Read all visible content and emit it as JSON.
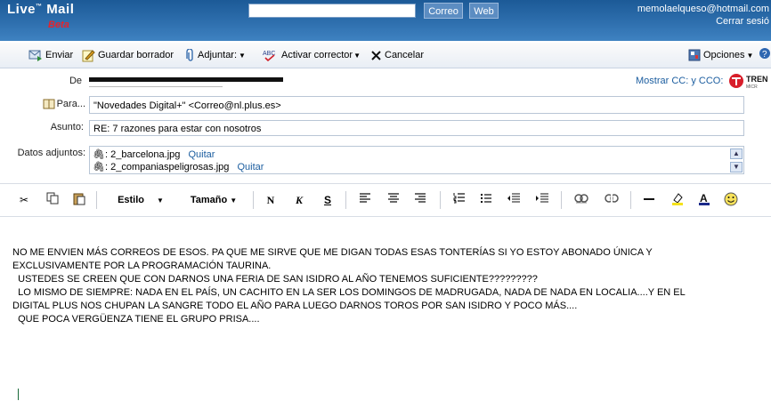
{
  "header": {
    "logo": "Live",
    "logo_tm": "™",
    "logo_product": "Mail",
    "beta": "Beta",
    "search_value": "",
    "btn_correo": "Correo",
    "btn_web": "Web",
    "user_email": "memolaelqueso@hotmail.com",
    "signout": "Cerrar sesió"
  },
  "toolbar": {
    "send": "Enviar",
    "save_draft": "Guardar borrador",
    "attach": "Adjuntar:",
    "spell": "Activar corrector",
    "cancel": "Cancelar",
    "options": "Opciones"
  },
  "compose": {
    "from_label": "De",
    "to_label": "Para...",
    "to_value": "\"Novedades Digital+\" <Correo@nl.plus.es>",
    "subject_label": "Asunto:",
    "subject_value": "RE: 7 razones para estar con nosotros",
    "attachments_label": "Datos adjuntos:",
    "attachments": [
      {
        "name": "2_barcelona.jpg",
        "remove": "Quitar"
      },
      {
        "name": "2_companiaspeligrosas.jpg",
        "remove": "Quitar"
      }
    ],
    "cc_link": "Mostrar CC: y CCO:",
    "trend_text": "TREN",
    "trend_sub": "MICR"
  },
  "format": {
    "style": "Estilo",
    "size": "Tamaño",
    "bold": "N",
    "italic": "K",
    "underline": "S"
  },
  "body_lines": [
    "NO ME ENVIEN MÁS CORREOS DE ESOS. PA QUE ME SIRVE QUE ME DIGAN TODAS ESAS TONTERÍAS SI YO ESTOY ABONADO ÚNICA Y",
    "EXCLUSIVAMENTE POR LA PROGRAMACIÓN TAURINA.",
    "  USTEDES SE CREEN QUE CON DARNOS UNA FERIA DE SAN ISIDRO AL AÑO TENEMOS SUFICIENTE?????????",
    "  LO MISMO DE SIEMPRE: NADA EN EL PAÍS, UN CACHITO EN LA SER LOS DOMINGOS DE MADRUGADA, NADA DE NADA EN LOCALIA....Y EN EL",
    "DIGITAL PLUS NOS CHUPAN LA SANGRE TODO EL AÑO PARA LUEGO DARNOS TOROS POR SAN ISIDRO Y POCO MÁS....",
    "  QUE POCA VERGÜENZA TIENE EL GRUPO PRISA...."
  ],
  "colors": {
    "header": "#2e6fae",
    "link": "#1b5d9f",
    "beta": "#e8222a"
  }
}
